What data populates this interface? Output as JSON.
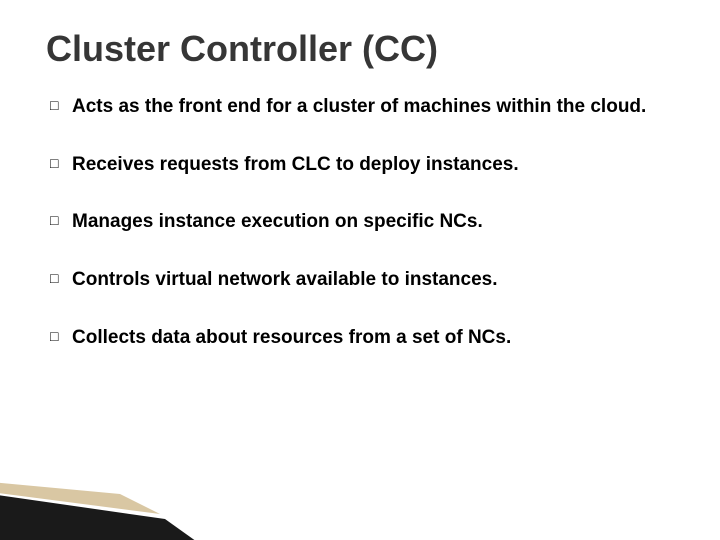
{
  "title": "Cluster Controller (CC)",
  "bullets": [
    "Acts as the front end for a cluster of machines within the cloud.",
    "Receives requests from CLC to deploy instances.",
    "Manages instance execution on specific NCs.",
    "Controls virtual network available to instances.",
    "Collects data about resources from a set of NCs."
  ]
}
